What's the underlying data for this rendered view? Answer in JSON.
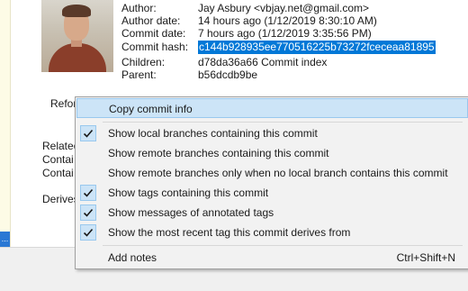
{
  "commit": {
    "author_label": "Author:",
    "author": "Jay Asbury <vbjay.net@gmail.com>",
    "author_date_label": "Author date:",
    "author_date": "14 hours ago (1/12/2019 8:30:10 AM)",
    "commit_date_label": "Commit date:",
    "commit_date": "7 hours ago (1/12/2019 3:35:56 PM)",
    "hash_label": "Commit hash:",
    "hash": "c144b928935ee770516225b73272fceceaa81895",
    "children_label": "Children:",
    "children": "d78da36a66 Commit index",
    "parent_label": "Parent:",
    "parent": "b56dcdb9be"
  },
  "background_labels": {
    "refs": "Refor",
    "related_1": "Related",
    "related_2": "Contai",
    "related_3": "Contai",
    "derives": "Derives"
  },
  "left_strip": {
    "button_text": "..."
  },
  "context_menu": {
    "items": [
      {
        "label": "Copy commit info",
        "checked": false,
        "highlighted": true
      },
      {
        "label": "Show local branches containing this commit",
        "checked": true
      },
      {
        "label": "Show remote branches containing this commit",
        "checked": false
      },
      {
        "label": "Show remote branches only when no local branch contains this commit",
        "checked": false
      },
      {
        "label": "Show tags containing this commit",
        "checked": true
      },
      {
        "label": "Show messages of annotated tags",
        "checked": true
      },
      {
        "label": "Show the most recent tag this commit derives from",
        "checked": true
      },
      {
        "label": "Add notes",
        "checked": false,
        "shortcut": "Ctrl+Shift+N"
      }
    ]
  },
  "colors": {
    "selection": "#0078d7",
    "menu_highlight": "#cce4f7",
    "menu_bg": "#f2f2f2"
  }
}
